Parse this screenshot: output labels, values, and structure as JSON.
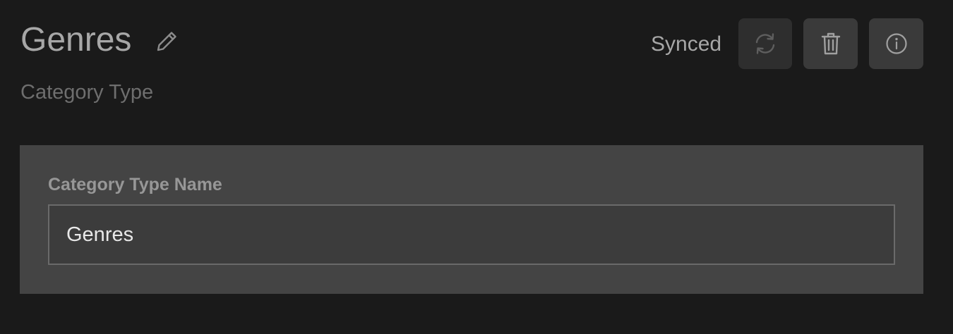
{
  "header": {
    "title": "Genres",
    "subtitle": "Category Type",
    "status": "Synced"
  },
  "icons": {
    "edit": "pencil-icon",
    "sync": "refresh-icon",
    "delete": "trash-icon",
    "info": "info-icon"
  },
  "form": {
    "name_label": "Category Type Name",
    "name_value": "Genres"
  },
  "colors": {
    "background": "#1a1a1a",
    "panel": "#444444",
    "input_background": "#3c3c3c",
    "button": "#3a3a3a",
    "title_text": "#a7a7a7",
    "input_text": "#e8e8e8"
  }
}
